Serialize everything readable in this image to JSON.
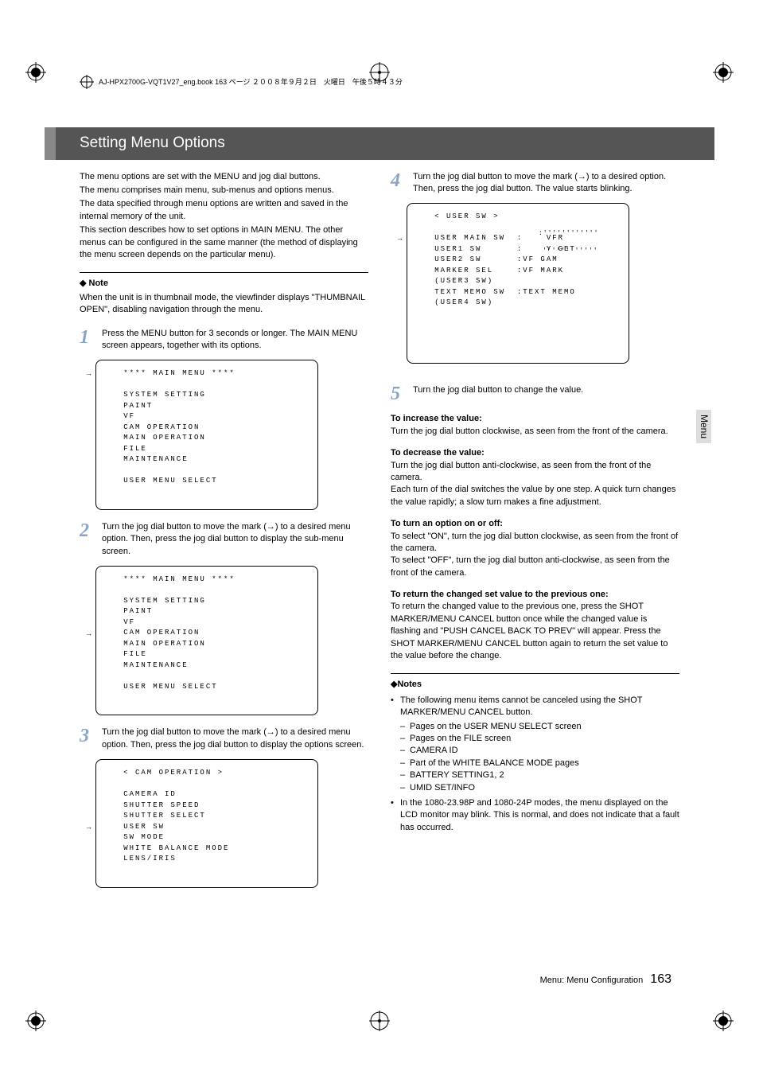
{
  "header_runner": "AJ-HPX2700G-VQT1V27_eng.book  163 ページ  ２００８年９月２日　火曜日　午後５時４３分",
  "title": "Setting Menu Options",
  "side_tab": "Menu",
  "intro": [
    "The menu options are set with the MENU and jog dial buttons.",
    "The menu comprises main menu, sub-menus and options menus.",
    "The data specified through menu options are written and saved in the internal memory of the unit.",
    "This section describes how to set options in MAIN MENU. The other menus can be configured in the same manner (the method of displaying the menu screen depends on the particular menu)."
  ],
  "note_label": "Note",
  "note_body": "When the unit is in thumbnail mode, the viewfinder displays \"THUMBNAIL OPEN\", disabling navigation through the menu.",
  "steps": {
    "s1": {
      "num": "1",
      "body": "Press the MENU button for 3 seconds or longer. The MAIN MENU screen appears, together with its options.",
      "screen": "   **** MAIN MENU ****\n\n   SYSTEM SETTING\n   PAINT\n   VF\n   CAM OPERATION\n   MAIN OPERATION\n   FILE\n   MAINTENANCE\n\n   USER MENU SELECT",
      "screen_arrow_line": 0
    },
    "s2": {
      "num": "2",
      "body": "Turn the jog dial button to move the mark (→) to a desired menu option. Then, press the jog dial button to display the sub-menu screen.",
      "screen": "   **** MAIN MENU ****\n\n   SYSTEM SETTING\n   PAINT\n   VF\n   CAM OPERATION\n   MAIN OPERATION\n   FILE\n   MAINTENANCE\n\n   USER MENU SELECT",
      "screen_arrow_line": 5
    },
    "s3": {
      "num": "3",
      "body": "Turn the jog dial button to move the mark (→) to a desired menu option. Then, press the jog dial button to display the options screen.",
      "screen": "   < CAM OPERATION >\n\n   CAMERA ID\n   SHUTTER SPEED\n   SHUTTER SELECT\n   USER SW\n   SW MODE\n   WHITE BALANCE MODE\n   LENS/IRIS",
      "screen_arrow_line": 5
    },
    "s4": {
      "num": "4",
      "body": "Turn the jog dial button to move the mark (→) to a desired option. Then, press the jog dial button. The value starts blinking.",
      "screen": "   < USER SW >\n\n   USER MAIN SW  :    VFR\n   USER1 SW      :    Y GET\n   USER2 SW      :VF GAM\n   MARKER SEL    :VF MARK\n   (USER3 SW)\n   TEXT MEMO SW  :TEXT MEMO\n   (USER4 SW)",
      "screen_arrow_line": 2,
      "hatch_top": ":''''''''''''",
      "hatch_bot": "''''''''''''"
    },
    "s5": {
      "num": "5",
      "body": "Turn the jog dial button to change the value."
    }
  },
  "adjust": {
    "increase_h": "To increase the value:",
    "increase_b": "Turn the jog dial button clockwise, as seen from the front of the camera.",
    "decrease_h": "To decrease the value:",
    "decrease_b": "Turn the jog dial button anti-clockwise, as seen from the front of the camera.\nEach turn of the dial switches the value by one step. A quick turn changes the value rapidly; a slow turn makes a fine adjustment.",
    "onoff_h": "To turn an option on or off:",
    "onoff_b": "To select \"ON\", turn the jog dial button clockwise, as seen from the front of the camera.\nTo select \"OFF\", turn the jog dial button anti-clockwise, as seen from the front of the camera.",
    "return_h": "To return the changed set value to the previous one:",
    "return_b": "To return the changed value to the previous one, press the SHOT MARKER/MENU CANCEL button once while the changed value is flashing and \"PUSH CANCEL BACK TO PREV\" will appear. Press the SHOT MARKER/MENU CANCEL button again to return the set value to the value before the change."
  },
  "notes2_label": "Notes",
  "notes2_bullets": [
    {
      "text": "The following menu items cannot be canceled using the SHOT MARKER/MENU CANCEL button.",
      "sub": [
        "Pages on the USER MENU SELECT screen",
        "Pages on the FILE screen",
        "CAMERA ID",
        "Part of the WHITE BALANCE MODE pages",
        "BATTERY SETTING1, 2",
        "UMID SET/INFO"
      ]
    },
    {
      "text": "In the 1080-23.98P and 1080-24P modes, the menu displayed on the LCD monitor may blink. This is normal, and does not indicate that a fault has occurred."
    }
  ],
  "footer_label": "Menu: Menu Configuration",
  "footer_page": "163"
}
